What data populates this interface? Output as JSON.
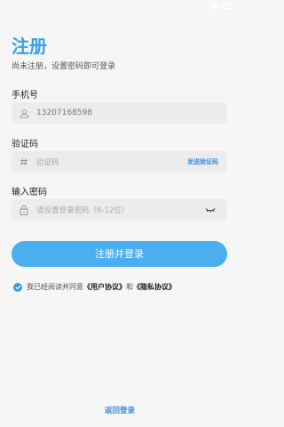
{
  "header": {
    "title": "注册",
    "subtitle": "尚未注册，设置密码即可登录"
  },
  "phone": {
    "label": "手机号",
    "value": "13207168598",
    "icon": "person-icon"
  },
  "code": {
    "label": "验证码",
    "placeholder": "验证码",
    "icon": "hash-icon",
    "send_label": "发送验证码"
  },
  "password": {
    "label": "输入密码",
    "placeholder": "请设置登录密码（6-12位）",
    "icon": "lock-icon",
    "toggle_icon": "eye-closed-icon"
  },
  "submit": {
    "label": "注册并登录"
  },
  "agreement": {
    "prefix": "我已经阅读并同意",
    "user_agreement": "《用户协议》",
    "and": "和",
    "privacy": "《隐私协议》",
    "checked": true
  },
  "footer": {
    "back_label": "返回登录"
  },
  "colors": {
    "accent": "#3aa0ea",
    "button": "#4aaef1",
    "link": "#3a8fe0"
  }
}
